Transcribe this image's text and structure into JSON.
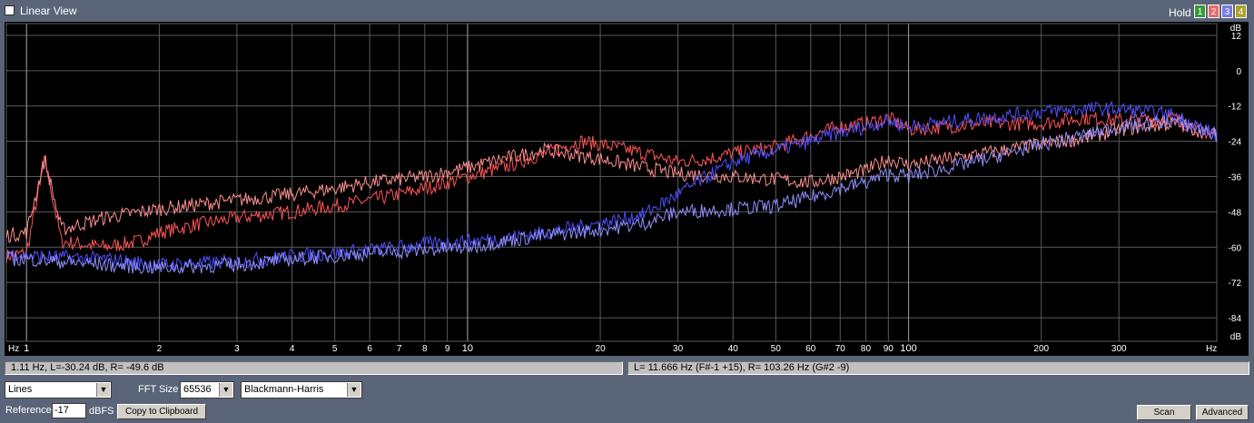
{
  "header": {
    "title": "Linear View",
    "hold_label": "Hold",
    "hold_buttons": [
      {
        "label": "1",
        "color": "#3a9a3a"
      },
      {
        "label": "2",
        "color": "#e86a6a"
      },
      {
        "label": "3",
        "color": "#7a7ae0"
      },
      {
        "label": "4",
        "color": "#b0a030"
      }
    ]
  },
  "chart_data": {
    "type": "line",
    "xscale": "log",
    "xlim": [
      0.9,
      500
    ],
    "ylim": [
      -92,
      16
    ],
    "x_ticks": [
      1,
      2,
      3,
      4,
      5,
      6,
      7,
      8,
      9,
      10,
      20,
      30,
      40,
      50,
      60,
      70,
      80,
      90,
      100,
      200,
      300
    ],
    "x_tick_labels": [
      "1",
      "2",
      "3",
      "4",
      "5",
      "6",
      "7",
      "8",
      "9",
      "10",
      "20",
      "30",
      "40",
      "50",
      "60",
      "70",
      "80",
      "90",
      "100",
      "200",
      "300"
    ],
    "x_unit": "Hz",
    "y_ticks": [
      12,
      0,
      -12,
      -24,
      -36,
      -48,
      -60,
      -72,
      -84
    ],
    "y_tick_labels": [
      "12",
      "0",
      "-12",
      "-24",
      "-36",
      "-48",
      "-60",
      "-72",
      "-84"
    ],
    "y_unit": "dB",
    "grid": true,
    "series": [
      {
        "color": "#ff5555",
        "points": [
          [
            0.9,
            -63
          ],
          [
            1.0,
            -62
          ],
          [
            1.1,
            -30
          ],
          [
            1.2,
            -58
          ],
          [
            1.5,
            -60
          ],
          [
            1.8,
            -58
          ],
          [
            2,
            -55
          ],
          [
            2.5,
            -52
          ],
          [
            3,
            -50
          ],
          [
            4,
            -48
          ],
          [
            5,
            -46
          ],
          [
            6,
            -44
          ],
          [
            7,
            -42
          ],
          [
            8,
            -40
          ],
          [
            9,
            -38
          ],
          [
            10,
            -36
          ],
          [
            12,
            -33
          ],
          [
            15,
            -28
          ],
          [
            18,
            -24
          ],
          [
            20,
            -25
          ],
          [
            25,
            -28
          ],
          [
            30,
            -31
          ],
          [
            35,
            -30
          ],
          [
            40,
            -28
          ],
          [
            50,
            -26
          ],
          [
            60,
            -22
          ],
          [
            70,
            -19
          ],
          [
            80,
            -18
          ],
          [
            90,
            -16
          ],
          [
            100,
            -20
          ],
          [
            150,
            -18
          ],
          [
            200,
            -18
          ],
          [
            250,
            -16
          ],
          [
            300,
            -17
          ],
          [
            400,
            -16
          ],
          [
            450,
            -20
          ],
          [
            500,
            -22
          ]
        ]
      },
      {
        "color": "#ff9090",
        "points": [
          [
            0.9,
            -56
          ],
          [
            1.0,
            -55
          ],
          [
            1.1,
            -30
          ],
          [
            1.2,
            -54
          ],
          [
            1.5,
            -50
          ],
          [
            2,
            -47
          ],
          [
            3,
            -44
          ],
          [
            4,
            -42
          ],
          [
            5,
            -40
          ],
          [
            6,
            -38
          ],
          [
            8,
            -36
          ],
          [
            10,
            -33
          ],
          [
            12,
            -30
          ],
          [
            15,
            -27
          ],
          [
            20,
            -30
          ],
          [
            25,
            -33
          ],
          [
            30,
            -35
          ],
          [
            40,
            -36
          ],
          [
            50,
            -37
          ],
          [
            60,
            -38
          ],
          [
            70,
            -36
          ],
          [
            80,
            -34
          ],
          [
            90,
            -30
          ],
          [
            100,
            -32
          ],
          [
            150,
            -28
          ],
          [
            200,
            -25
          ],
          [
            250,
            -23
          ],
          [
            300,
            -20
          ],
          [
            400,
            -18
          ],
          [
            500,
            -22
          ]
        ]
      },
      {
        "color": "#5050ff",
        "points": [
          [
            0.9,
            -62
          ],
          [
            1.0,
            -63
          ],
          [
            1.5,
            -64
          ],
          [
            2,
            -66
          ],
          [
            3,
            -65
          ],
          [
            4,
            -63
          ],
          [
            5,
            -62
          ],
          [
            6,
            -61
          ],
          [
            7,
            -60
          ],
          [
            8,
            -59
          ],
          [
            10,
            -58
          ],
          [
            12,
            -57
          ],
          [
            15,
            -55
          ],
          [
            20,
            -52
          ],
          [
            25,
            -49
          ],
          [
            30,
            -42
          ],
          [
            35,
            -36
          ],
          [
            40,
            -31
          ],
          [
            50,
            -27
          ],
          [
            60,
            -24
          ],
          [
            70,
            -21
          ],
          [
            80,
            -19
          ],
          [
            90,
            -17
          ],
          [
            100,
            -19
          ],
          [
            150,
            -16
          ],
          [
            200,
            -14
          ],
          [
            250,
            -13
          ],
          [
            300,
            -13
          ],
          [
            400,
            -15
          ],
          [
            500,
            -22
          ]
        ]
      },
      {
        "color": "#9090ff",
        "points": [
          [
            0.9,
            -64
          ],
          [
            1.0,
            -64
          ],
          [
            1.5,
            -66
          ],
          [
            2,
            -67
          ],
          [
            3,
            -66
          ],
          [
            4,
            -64
          ],
          [
            5,
            -63
          ],
          [
            6,
            -62
          ],
          [
            8,
            -61
          ],
          [
            10,
            -60
          ],
          [
            12,
            -58
          ],
          [
            15,
            -56
          ],
          [
            20,
            -54
          ],
          [
            25,
            -52
          ],
          [
            30,
            -48
          ],
          [
            40,
            -47
          ],
          [
            50,
            -46
          ],
          [
            60,
            -43
          ],
          [
            70,
            -40
          ],
          [
            80,
            -38
          ],
          [
            90,
            -35
          ],
          [
            100,
            -36
          ],
          [
            150,
            -30
          ],
          [
            200,
            -25
          ],
          [
            250,
            -22
          ],
          [
            300,
            -19
          ],
          [
            400,
            -17
          ],
          [
            500,
            -22
          ]
        ]
      }
    ]
  },
  "status": {
    "left": "1.11 Hz, L=-30.24 dB, R= -49.6 dB",
    "right": "L= 11.666 Hz (F#-1 +15), R= 103.26 Hz (G#2 -9)"
  },
  "controls": {
    "display_mode": "Lines",
    "fft_size_label": "FFT Size",
    "fft_size": "65536",
    "window": "Blackmann-Harris",
    "reference_label": "Reference",
    "reference_value": "-17",
    "reference_unit": "dBFS",
    "copy_button": "Copy to Clipboard",
    "scan_button": "Scan",
    "advanced_button": "Advanced"
  }
}
